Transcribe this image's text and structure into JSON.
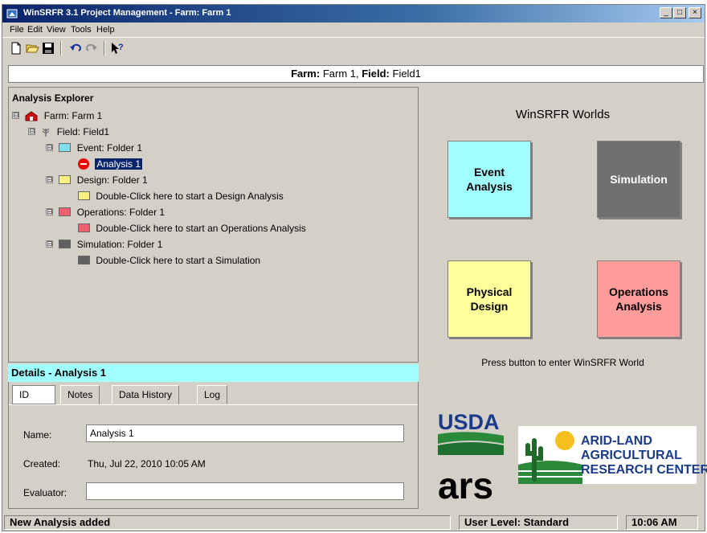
{
  "window": {
    "title": "WinSRFR 3.1 Project Management - Farm: Farm 1",
    "controls": [
      "_",
      "□",
      "×"
    ]
  },
  "menu": [
    "File",
    "Edit",
    "View",
    "Tools",
    "Help"
  ],
  "toolbar": {
    "icons": [
      "new-file-icon",
      "open-folder-icon",
      "save-icon",
      "undo-icon",
      "redo-icon",
      "context-help-icon"
    ]
  },
  "header": {
    "farm_label": "Farm:",
    "farm_value": " Farm 1, ",
    "field_label": "Field:",
    "field_value": " Field1"
  },
  "explorer": {
    "title": "Analysis Explorer",
    "nodes": [
      {
        "label": "Farm: Farm 1",
        "icon": "farm-icon",
        "expander": "⊟"
      },
      {
        "label": "Field: Field1",
        "icon": "field-icon",
        "expander": "⊟"
      },
      {
        "label": "Event: Folder 1",
        "icon": "folder-cyan-icon",
        "expander": "⊟",
        "color": "#80e0f0"
      },
      {
        "label": "Analysis 1",
        "icon": "stop-icon",
        "selected": true
      },
      {
        "label": "Design: Folder 1",
        "icon": "folder-yellow-icon",
        "expander": "⊟",
        "color": "#f8f080"
      },
      {
        "label": "Double-Click here to start a Design Analysis",
        "icon": "folder-yellow-icon",
        "color": "#f8f080"
      },
      {
        "label": "Operations: Folder 1",
        "icon": "folder-red-icon",
        "expander": "⊟",
        "color": "#f06070"
      },
      {
        "label": "Double-Click here to start an Operations Analysis",
        "icon": "folder-red-icon",
        "color": "#f06070"
      },
      {
        "label": "Simulation: Folder 1",
        "icon": "folder-gray-icon",
        "expander": "⊟",
        "color": "#606060"
      },
      {
        "label": "Double-Click here to start a Simulation",
        "icon": "folder-gray-icon",
        "color": "#606060"
      }
    ]
  },
  "details": {
    "title": "Details - Analysis 1",
    "tabs": [
      "ID",
      "Notes",
      "Data History",
      "Log"
    ],
    "active_tab": "ID",
    "name_label": "Name:",
    "name_value": "Analysis 1",
    "created_label": "Created:",
    "created_value": "Thu, Jul 22, 2010  10:05 AM",
    "evaluator_label": "Evaluator:",
    "evaluator_value": ""
  },
  "worlds": {
    "title": "WinSRFR Worlds",
    "buttons": [
      {
        "label": "Event\nAnalysis",
        "color": "#a0ffff",
        "text_color": "#000000"
      },
      {
        "label": "Simulation",
        "color": "#707070",
        "text_color": "#ffffff"
      },
      {
        "label": "Physical\nDesign",
        "color": "#ffff9c",
        "text_color": "#000000"
      },
      {
        "label": "Operations\nAnalysis",
        "color": "#ff9c9c",
        "text_color": "#000000"
      }
    ],
    "hint": "Press button to enter WinSRFR World"
  },
  "logos": {
    "usda": "USDA",
    "ars": "ars",
    "arid_line1": "ARID-LAND",
    "arid_line2": "AGRICULTURAL",
    "arid_line3": "RESEARCH CENTER"
  },
  "status": {
    "message": "New Analysis added",
    "user_level": "User Level:  Standard",
    "time": "10:06 AM"
  }
}
